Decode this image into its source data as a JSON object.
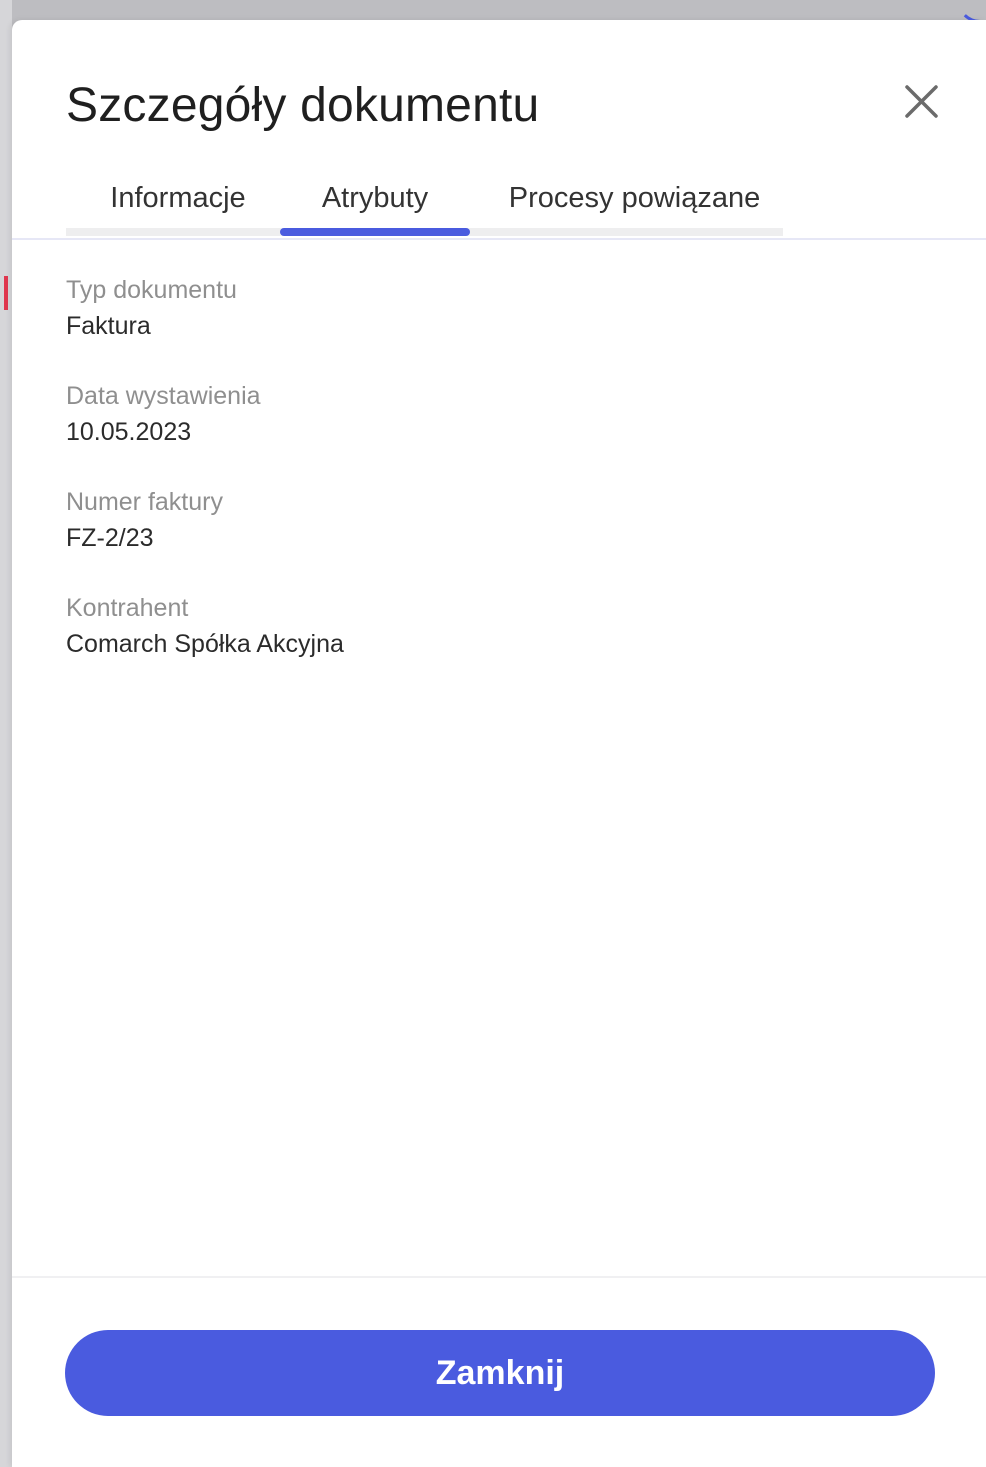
{
  "dialog": {
    "title": "Szczegóły dokumentu",
    "close_icon": "close-icon"
  },
  "tabs": [
    {
      "label": "Informacje",
      "active": false
    },
    {
      "label": "Atrybuty",
      "active": true
    },
    {
      "label": "Procesy powiązane",
      "active": false
    }
  ],
  "fields": [
    {
      "label": "Typ dokumentu",
      "value": "Faktura"
    },
    {
      "label": "Data wystawienia",
      "value": "10.05.2023"
    },
    {
      "label": "Numer faktury",
      "value": "FZ-2/23"
    },
    {
      "label": "Kontrahent",
      "value": "Comarch Spółka Akcyjna"
    }
  ],
  "footer": {
    "close_label": "Zamknij"
  },
  "colors": {
    "accent": "#4a5bdf",
    "label": "#8f8f8f",
    "text": "#2b2b2b"
  }
}
